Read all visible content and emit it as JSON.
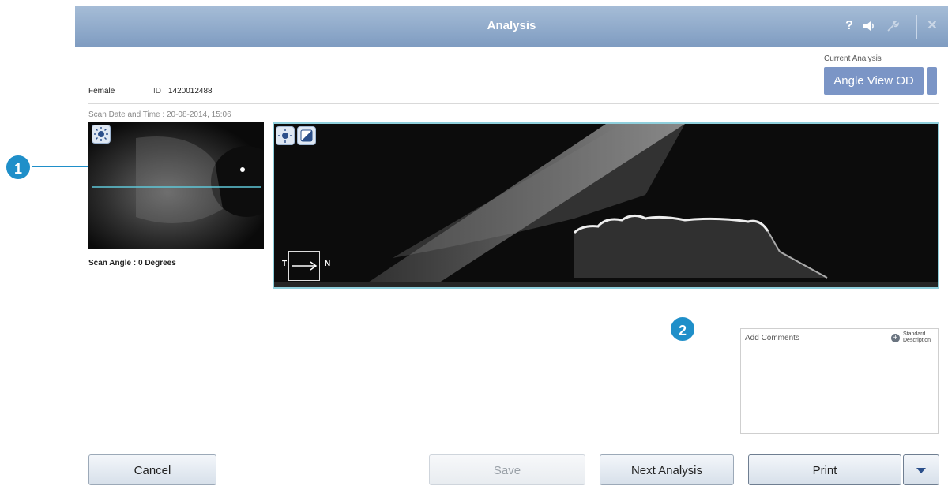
{
  "titlebar": {
    "title": "Analysis",
    "help_icon": "?",
    "volume_icon": "speaker-icon",
    "tools_icon": "wrench-icon",
    "close_icon": "✕"
  },
  "patient": {
    "gender": "Female",
    "id_label": "ID",
    "id_value": "1420012488"
  },
  "scan": {
    "date_time": "Scan Date and Time :  20-08-2014, 15:06",
    "angle": "Scan Angle :  0 Degrees"
  },
  "current_analysis": {
    "label": "Current Analysis",
    "value": "Angle View OD"
  },
  "orientation": {
    "left": "T",
    "right": "N"
  },
  "callouts": {
    "one": "1",
    "two": "2"
  },
  "comments": {
    "title": "Add Comments",
    "standard_label_1": "Standard",
    "standard_label_2": "Description"
  },
  "buttons": {
    "cancel": "Cancel",
    "save": "Save",
    "next": "Next Analysis",
    "print": "Print"
  },
  "colors": {
    "titlebar": "#8aa6c8",
    "accent": "#7b95c6",
    "callout": "#1f8fc9",
    "scanline": "#5fc7d8"
  }
}
